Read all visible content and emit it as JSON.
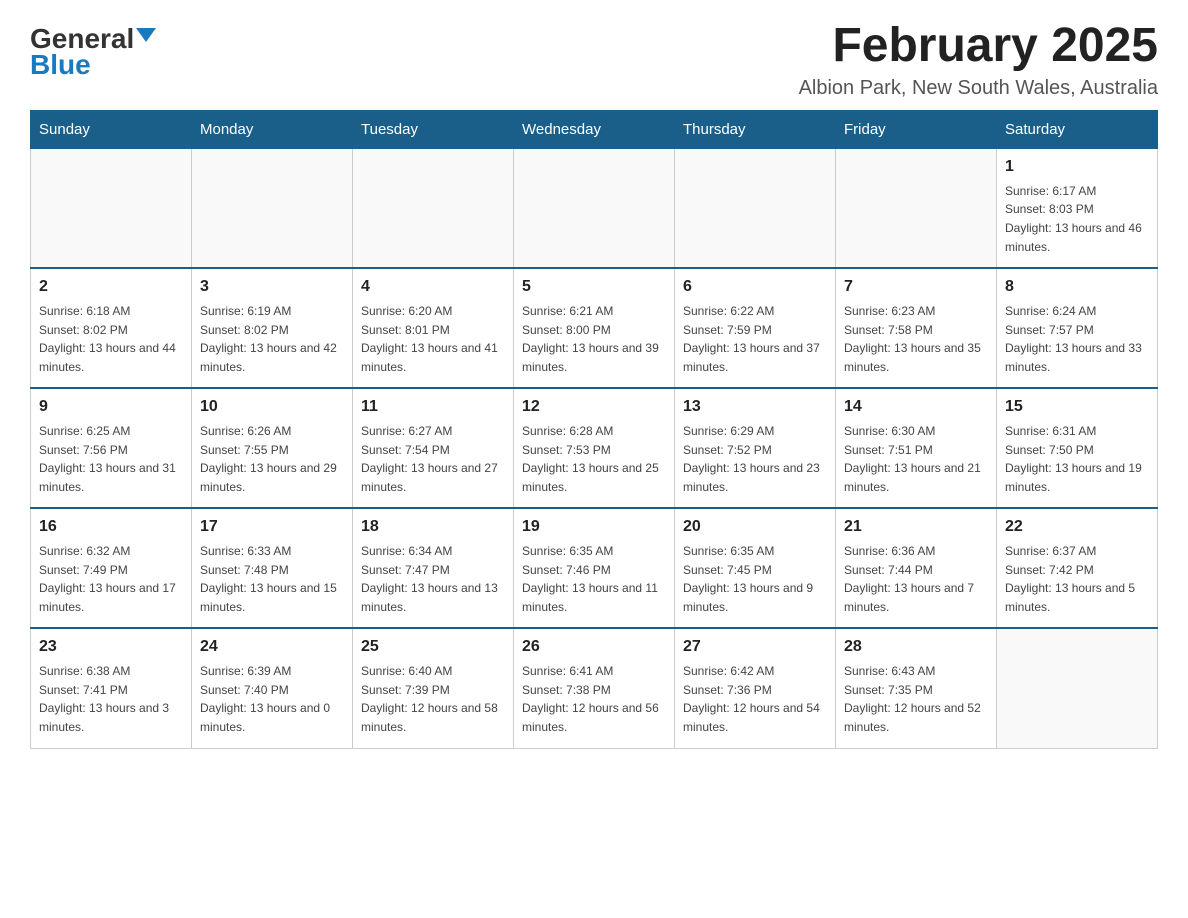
{
  "header": {
    "logo_general": "General",
    "logo_blue": "Blue",
    "month_title": "February 2025",
    "location": "Albion Park, New South Wales, Australia"
  },
  "weekdays": [
    "Sunday",
    "Monday",
    "Tuesday",
    "Wednesday",
    "Thursday",
    "Friday",
    "Saturday"
  ],
  "weeks": [
    [
      {
        "day": "",
        "info": ""
      },
      {
        "day": "",
        "info": ""
      },
      {
        "day": "",
        "info": ""
      },
      {
        "day": "",
        "info": ""
      },
      {
        "day": "",
        "info": ""
      },
      {
        "day": "",
        "info": ""
      },
      {
        "day": "1",
        "info": "Sunrise: 6:17 AM\nSunset: 8:03 PM\nDaylight: 13 hours and 46 minutes."
      }
    ],
    [
      {
        "day": "2",
        "info": "Sunrise: 6:18 AM\nSunset: 8:02 PM\nDaylight: 13 hours and 44 minutes."
      },
      {
        "day": "3",
        "info": "Sunrise: 6:19 AM\nSunset: 8:02 PM\nDaylight: 13 hours and 42 minutes."
      },
      {
        "day": "4",
        "info": "Sunrise: 6:20 AM\nSunset: 8:01 PM\nDaylight: 13 hours and 41 minutes."
      },
      {
        "day": "5",
        "info": "Sunrise: 6:21 AM\nSunset: 8:00 PM\nDaylight: 13 hours and 39 minutes."
      },
      {
        "day": "6",
        "info": "Sunrise: 6:22 AM\nSunset: 7:59 PM\nDaylight: 13 hours and 37 minutes."
      },
      {
        "day": "7",
        "info": "Sunrise: 6:23 AM\nSunset: 7:58 PM\nDaylight: 13 hours and 35 minutes."
      },
      {
        "day": "8",
        "info": "Sunrise: 6:24 AM\nSunset: 7:57 PM\nDaylight: 13 hours and 33 minutes."
      }
    ],
    [
      {
        "day": "9",
        "info": "Sunrise: 6:25 AM\nSunset: 7:56 PM\nDaylight: 13 hours and 31 minutes."
      },
      {
        "day": "10",
        "info": "Sunrise: 6:26 AM\nSunset: 7:55 PM\nDaylight: 13 hours and 29 minutes."
      },
      {
        "day": "11",
        "info": "Sunrise: 6:27 AM\nSunset: 7:54 PM\nDaylight: 13 hours and 27 minutes."
      },
      {
        "day": "12",
        "info": "Sunrise: 6:28 AM\nSunset: 7:53 PM\nDaylight: 13 hours and 25 minutes."
      },
      {
        "day": "13",
        "info": "Sunrise: 6:29 AM\nSunset: 7:52 PM\nDaylight: 13 hours and 23 minutes."
      },
      {
        "day": "14",
        "info": "Sunrise: 6:30 AM\nSunset: 7:51 PM\nDaylight: 13 hours and 21 minutes."
      },
      {
        "day": "15",
        "info": "Sunrise: 6:31 AM\nSunset: 7:50 PM\nDaylight: 13 hours and 19 minutes."
      }
    ],
    [
      {
        "day": "16",
        "info": "Sunrise: 6:32 AM\nSunset: 7:49 PM\nDaylight: 13 hours and 17 minutes."
      },
      {
        "day": "17",
        "info": "Sunrise: 6:33 AM\nSunset: 7:48 PM\nDaylight: 13 hours and 15 minutes."
      },
      {
        "day": "18",
        "info": "Sunrise: 6:34 AM\nSunset: 7:47 PM\nDaylight: 13 hours and 13 minutes."
      },
      {
        "day": "19",
        "info": "Sunrise: 6:35 AM\nSunset: 7:46 PM\nDaylight: 13 hours and 11 minutes."
      },
      {
        "day": "20",
        "info": "Sunrise: 6:35 AM\nSunset: 7:45 PM\nDaylight: 13 hours and 9 minutes."
      },
      {
        "day": "21",
        "info": "Sunrise: 6:36 AM\nSunset: 7:44 PM\nDaylight: 13 hours and 7 minutes."
      },
      {
        "day": "22",
        "info": "Sunrise: 6:37 AM\nSunset: 7:42 PM\nDaylight: 13 hours and 5 minutes."
      }
    ],
    [
      {
        "day": "23",
        "info": "Sunrise: 6:38 AM\nSunset: 7:41 PM\nDaylight: 13 hours and 3 minutes."
      },
      {
        "day": "24",
        "info": "Sunrise: 6:39 AM\nSunset: 7:40 PM\nDaylight: 13 hours and 0 minutes."
      },
      {
        "day": "25",
        "info": "Sunrise: 6:40 AM\nSunset: 7:39 PM\nDaylight: 12 hours and 58 minutes."
      },
      {
        "day": "26",
        "info": "Sunrise: 6:41 AM\nSunset: 7:38 PM\nDaylight: 12 hours and 56 minutes."
      },
      {
        "day": "27",
        "info": "Sunrise: 6:42 AM\nSunset: 7:36 PM\nDaylight: 12 hours and 54 minutes."
      },
      {
        "day": "28",
        "info": "Sunrise: 6:43 AM\nSunset: 7:35 PM\nDaylight: 12 hours and 52 minutes."
      },
      {
        "day": "",
        "info": ""
      }
    ]
  ]
}
